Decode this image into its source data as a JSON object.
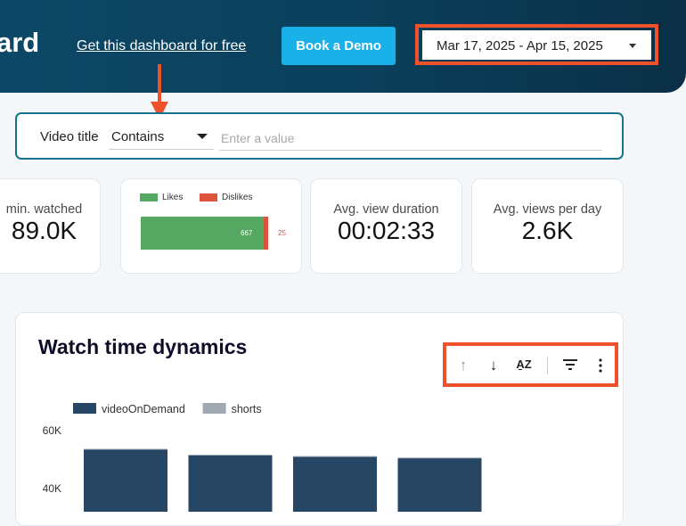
{
  "header": {
    "brand_fragment": "ard",
    "free_link": "Get this dashboard for free",
    "demo_button": "Book a Demo",
    "date_range": "Mar 17, 2025 - Apr 15, 2025"
  },
  "filter": {
    "label": "Video title",
    "operator": "Contains",
    "value": "",
    "placeholder": "Enter a value"
  },
  "kpis": {
    "minutes_watched": {
      "label": "min. watched",
      "value": "89.0K"
    },
    "avg_view_duration": {
      "label": "Avg. view duration",
      "value": "00:02:33"
    },
    "avg_views_per_day": {
      "label": "Avg. views per day",
      "value": "2.6K"
    }
  },
  "likes_chart": {
    "legend": [
      {
        "name": "Likes",
        "color": "#55a862"
      },
      {
        "name": "Dislikes",
        "color": "#dd543d"
      }
    ],
    "likes_value": "667",
    "dislikes_value": "25"
  },
  "watch_time": {
    "title": "Watch time dynamics",
    "toolbar": {
      "sort_asc_icon": "arrow-up-icon",
      "sort_desc_icon": "arrow-down-icon",
      "sort_az_icon": "sort-az-icon",
      "filter_icon": "filter-icon",
      "more_icon": "more-vertical-icon"
    }
  },
  "chart_data": {
    "type": "bar",
    "stacked": true,
    "series": [
      {
        "name": "videoOnDemand",
        "color": "#264664",
        "values": [
          53500,
          51500,
          51000,
          50500
        ]
      },
      {
        "name": "shorts",
        "color": "#a0a8b2",
        "values": [
          200,
          200,
          200,
          200
        ]
      }
    ],
    "y_ticks": [
      "60K",
      "40K"
    ],
    "ylim": [
      0,
      60000
    ],
    "grid": false,
    "legend_position": "top-left"
  },
  "colors": {
    "header_bg": "#0c4866",
    "accent_button": "#1ab0e8",
    "annotation": "#f0512d",
    "filter_border": "#17708f"
  }
}
